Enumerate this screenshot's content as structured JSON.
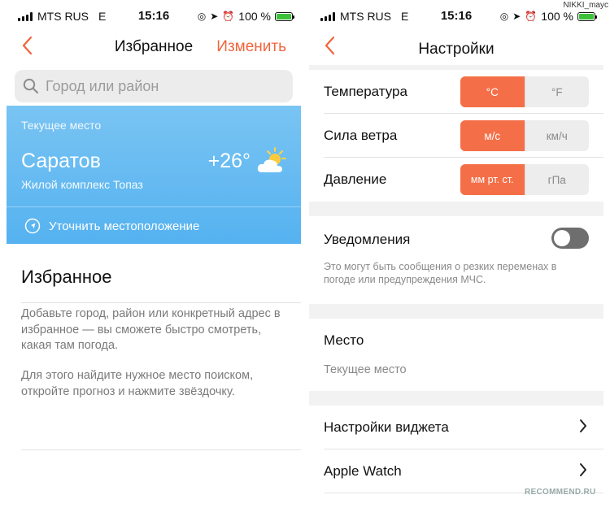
{
  "status": {
    "carrier": "MTS RUS",
    "network": "E",
    "time": "15:16",
    "battery": "100 %"
  },
  "left": {
    "nav": {
      "title": "Избранное",
      "action": "Изменить"
    },
    "search": {
      "placeholder": "Город или район"
    },
    "current": {
      "label": "Текущее место",
      "city": "Саратов",
      "sub": "Жилой комплекс Топаз",
      "temp": "+26°",
      "refine": "Уточнить местоположение"
    },
    "favorites": {
      "title": "Избранное",
      "text1": "Добавьте город, район или конкретный адрес в избранное — вы сможете быстро смотреть, какая там погода.",
      "text2": "Для этого найдите нужное место поиском, откройте прогноз и нажмите звёздочку."
    }
  },
  "right": {
    "nav": {
      "title": "Настройки"
    },
    "units": [
      {
        "label": "Температура",
        "opt1": "°C",
        "opt2": "°F"
      },
      {
        "label": "Сила ветра",
        "opt1": "м/с",
        "opt2": "км/ч"
      },
      {
        "label": "Давление",
        "opt1": "мм рт. ст.",
        "opt2": "гПа"
      }
    ],
    "notifications": {
      "label": "Уведомления",
      "note": "Это могут быть сообщения о резких переменах в погоде или предупреждения МЧС."
    },
    "place": {
      "label": "Место",
      "value": "Текущее место"
    },
    "widget": {
      "label": "Настройки виджета"
    },
    "watch": {
      "label": "Apple Watch"
    }
  },
  "watermark": {
    "site": "RECOMMEND.RU",
    "user": "NIKKI_mayc"
  },
  "colors": {
    "accent": "#f0643c",
    "card_blue": "#62b9f1",
    "toggle_off": "#6e6e6e"
  }
}
